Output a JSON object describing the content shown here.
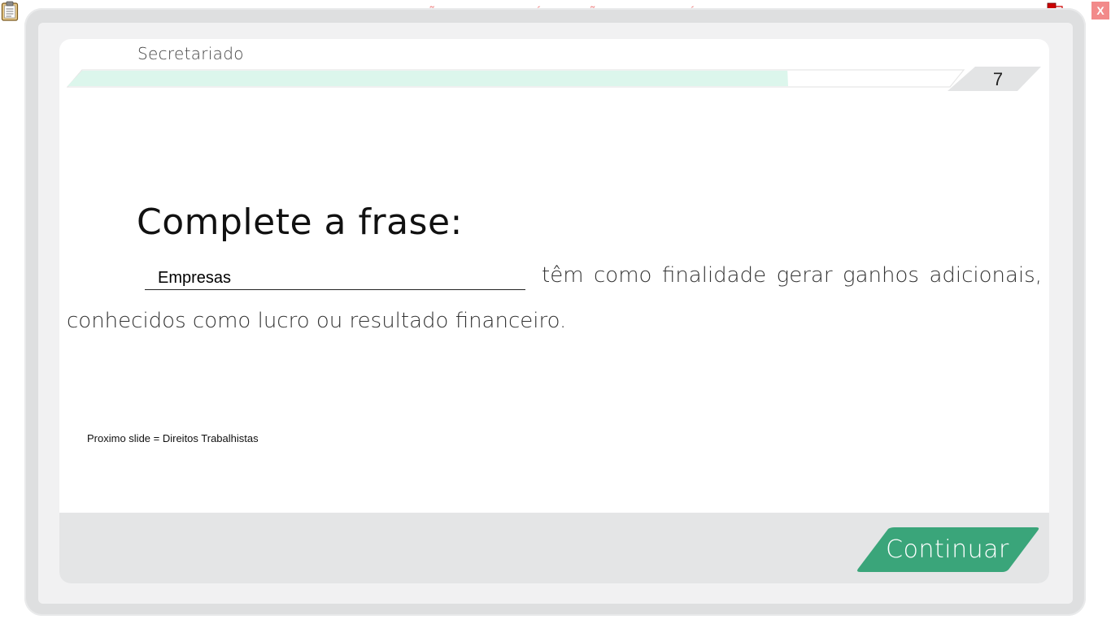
{
  "watermark": "VERSÃO PARA FUNCIONÁRIOS - NÃO COMERCIALIZÁVEL",
  "close_label": "X",
  "header": {
    "course_title": "Secretariado",
    "slide_number": "7",
    "progress_fraction": 0.8
  },
  "content": {
    "title": "Complete a frase:",
    "blank_value": "Empresas",
    "sentence_line1_rest": "têm como finalidade gerar ganhos adicionais,",
    "sentence_line2": "conhecidos como lucro ou resultado financeiro."
  },
  "note": "Proximo slide = Direitos Trabalhistas",
  "footer": {
    "continue_label": "Continuar"
  },
  "colors": {
    "accent": "#3aa57a",
    "progress_fill": "#dcf6ec",
    "watermark": "#f08585",
    "close": "#f28a8a"
  },
  "icons": [
    "clipboard-icon",
    "network-icon"
  ]
}
